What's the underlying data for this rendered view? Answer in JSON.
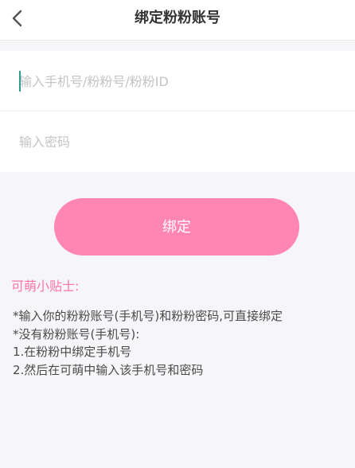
{
  "header": {
    "back_icon": "chevron-left-icon",
    "title": "绑定粉粉账号"
  },
  "form": {
    "account_placeholder": "输入手机号/粉粉号/粉粉ID",
    "password_placeholder": "输入密码"
  },
  "bind_button_label": "绑定",
  "tips": {
    "title": "可萌小贴士:",
    "lines": [
      "*输入你的粉粉账号(手机号)和粉粉密码,可直接绑定",
      "*没有粉粉账号(手机号):",
      "1.在粉粉中绑定手机号",
      "2.然后在可萌中输入该手机号和密码"
    ]
  },
  "colors": {
    "accent": "#ff85b3",
    "tips_title": "#ff73a6",
    "background": "#f6f6f9"
  }
}
